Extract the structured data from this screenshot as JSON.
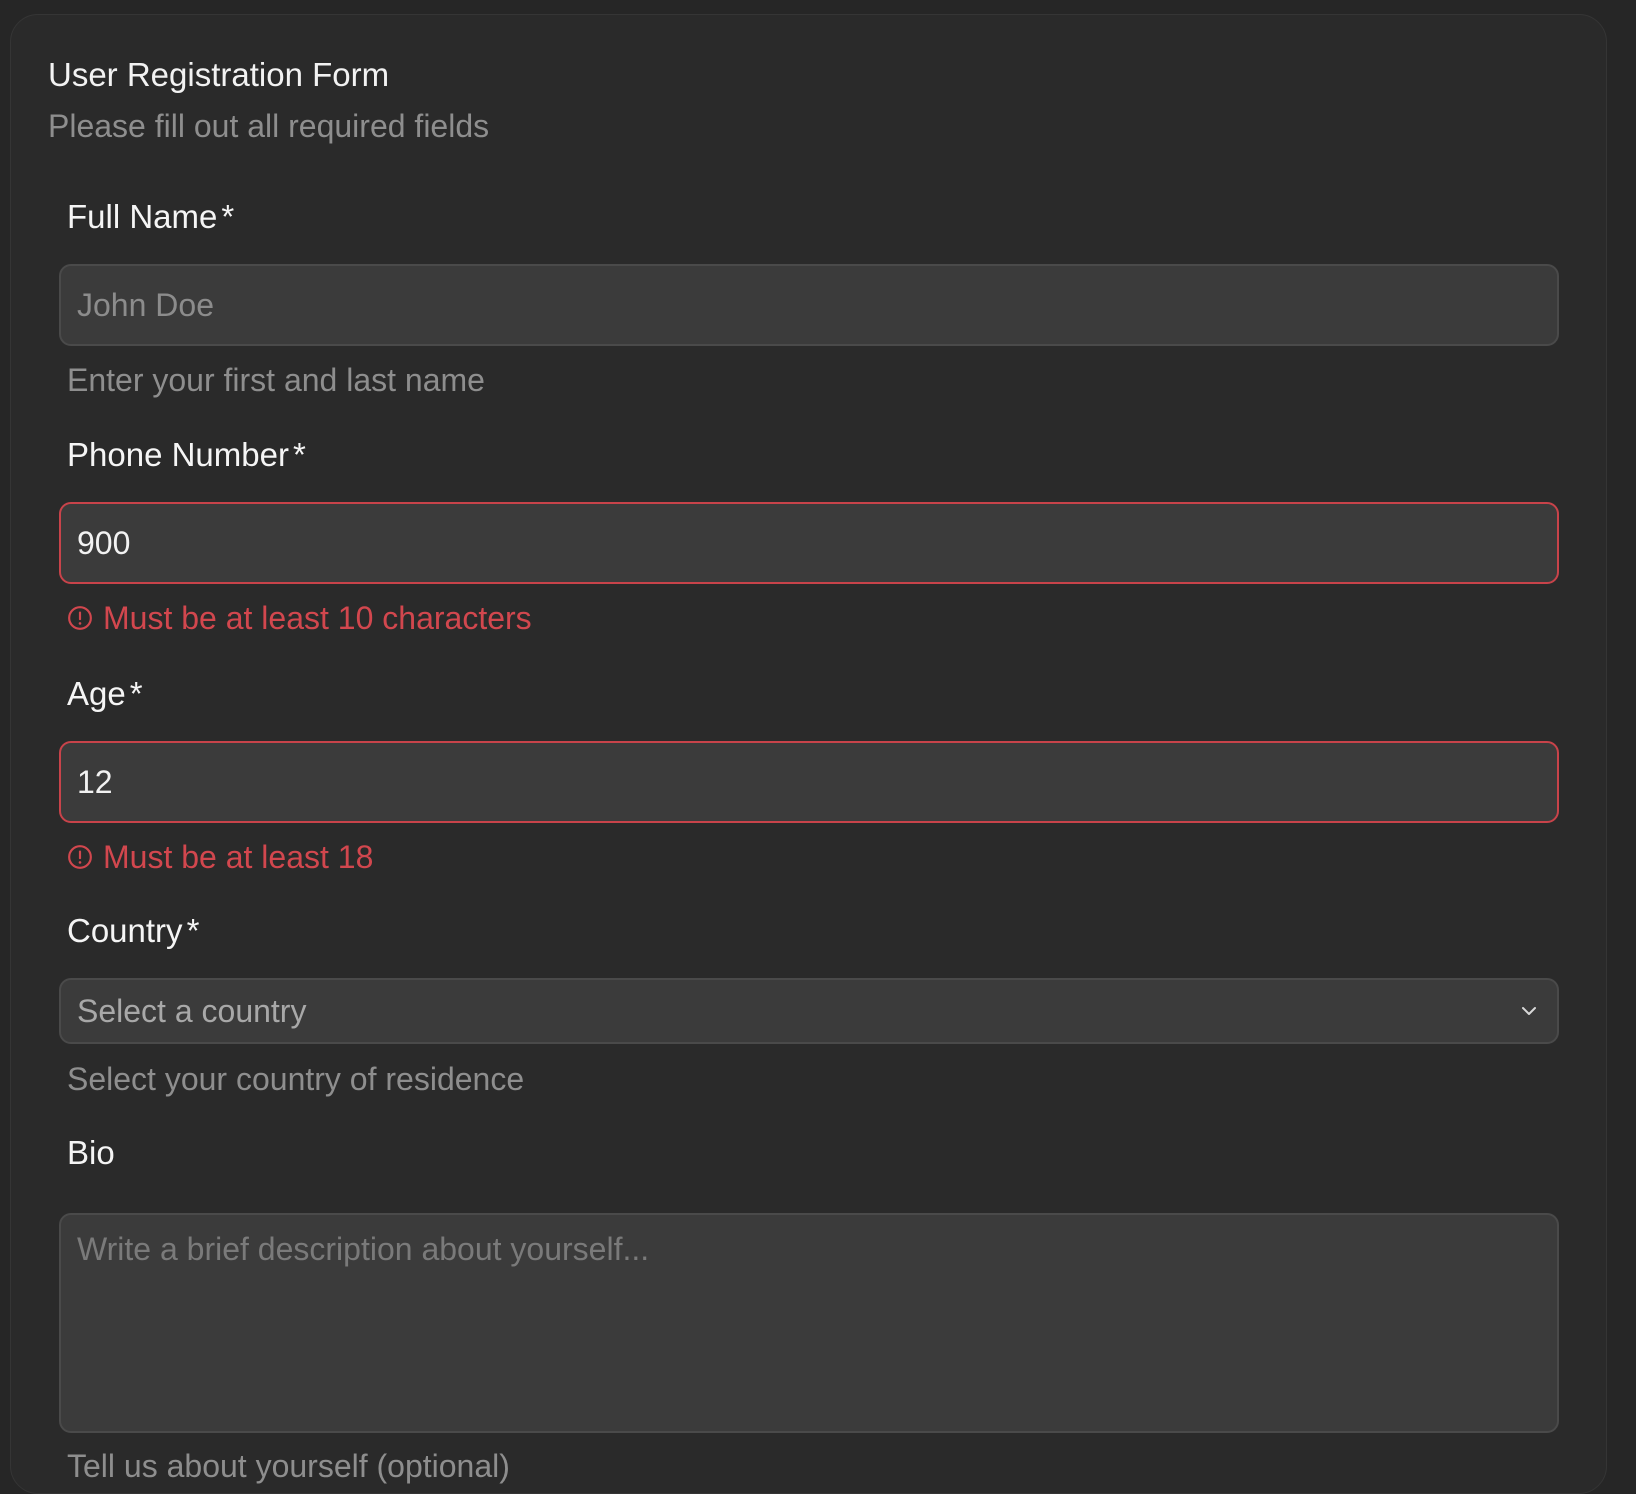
{
  "form": {
    "title": "User Registration Form",
    "subtitle": "Please fill out all required fields"
  },
  "fields": {
    "full_name": {
      "label": "Full Name",
      "required_marker": "*",
      "value": "",
      "placeholder": "John Doe",
      "hint": "Enter your first and last name"
    },
    "phone": {
      "label": "Phone Number",
      "required_marker": "*",
      "value": "900",
      "placeholder": "",
      "error": "Must be at least 10 characters"
    },
    "age": {
      "label": "Age",
      "required_marker": "*",
      "value": "12",
      "placeholder": "",
      "error": "Must be at least 18"
    },
    "country": {
      "label": "Country",
      "required_marker": "*",
      "selected": "Select a country",
      "hint": "Select your country of residence",
      "icon": "chevron-down-icon"
    },
    "bio": {
      "label": "Bio",
      "value": "",
      "placeholder": "Write a brief description about yourself...",
      "hint": "Tell us about yourself (optional)"
    }
  },
  "colors": {
    "background": "#262626",
    "card": "#2a2a2a",
    "input_bg": "#3b3b3b",
    "error": "#d2474e",
    "muted_text": "#8e8e8e"
  }
}
